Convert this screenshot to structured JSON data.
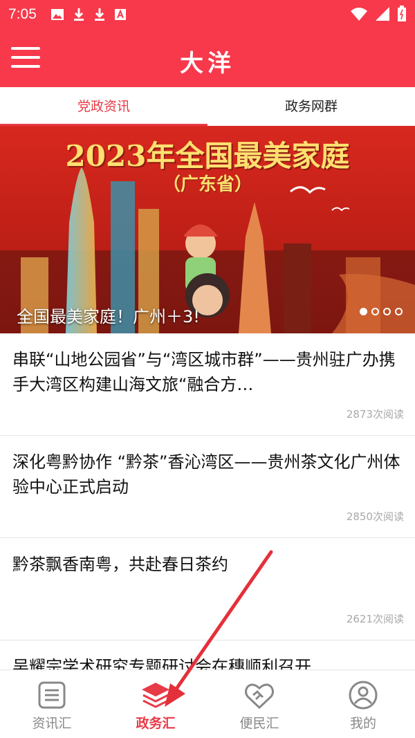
{
  "status_bar": {
    "time": "7:05"
  },
  "app_bar": {
    "title": "大洋"
  },
  "tabs": [
    {
      "label": "党政资讯",
      "active": true
    },
    {
      "label": "政务网群",
      "active": false
    }
  ],
  "banner": {
    "image_title": "2023年全国最美家庭",
    "image_subtitle": "（广东省）",
    "caption": "全国最美家庭！广州＋3!",
    "pages": 4,
    "current_page": 1
  },
  "news": [
    {
      "title": "串联“山地公园省”与“湾区城市群”——贵州驻广办携手大湾区构建山海文旅“融合方…",
      "reads": "2873次阅读"
    },
    {
      "title": "深化粤黔协作 “黔茶”香沁湾区——贵州茶文化广州体验中心正式启动",
      "reads": "2850次阅读"
    },
    {
      "title": "黔茶飘香南粤，共赴春日茶约",
      "reads": "2621次阅读"
    },
    {
      "title": "吴耀宗学术研究专题研讨会在穗顺利召开",
      "reads": ""
    }
  ],
  "bottom_nav": [
    {
      "label": "资讯汇",
      "icon": "news-icon",
      "active": false
    },
    {
      "label": "政务汇",
      "icon": "layers-icon",
      "active": true
    },
    {
      "label": "便民汇",
      "icon": "handshake-icon",
      "active": false
    },
    {
      "label": "我的",
      "icon": "profile-icon",
      "active": false
    }
  ],
  "colors": {
    "brand": "#f7394b",
    "accent": "#e83a47",
    "muted": "#a8a8a8"
  }
}
